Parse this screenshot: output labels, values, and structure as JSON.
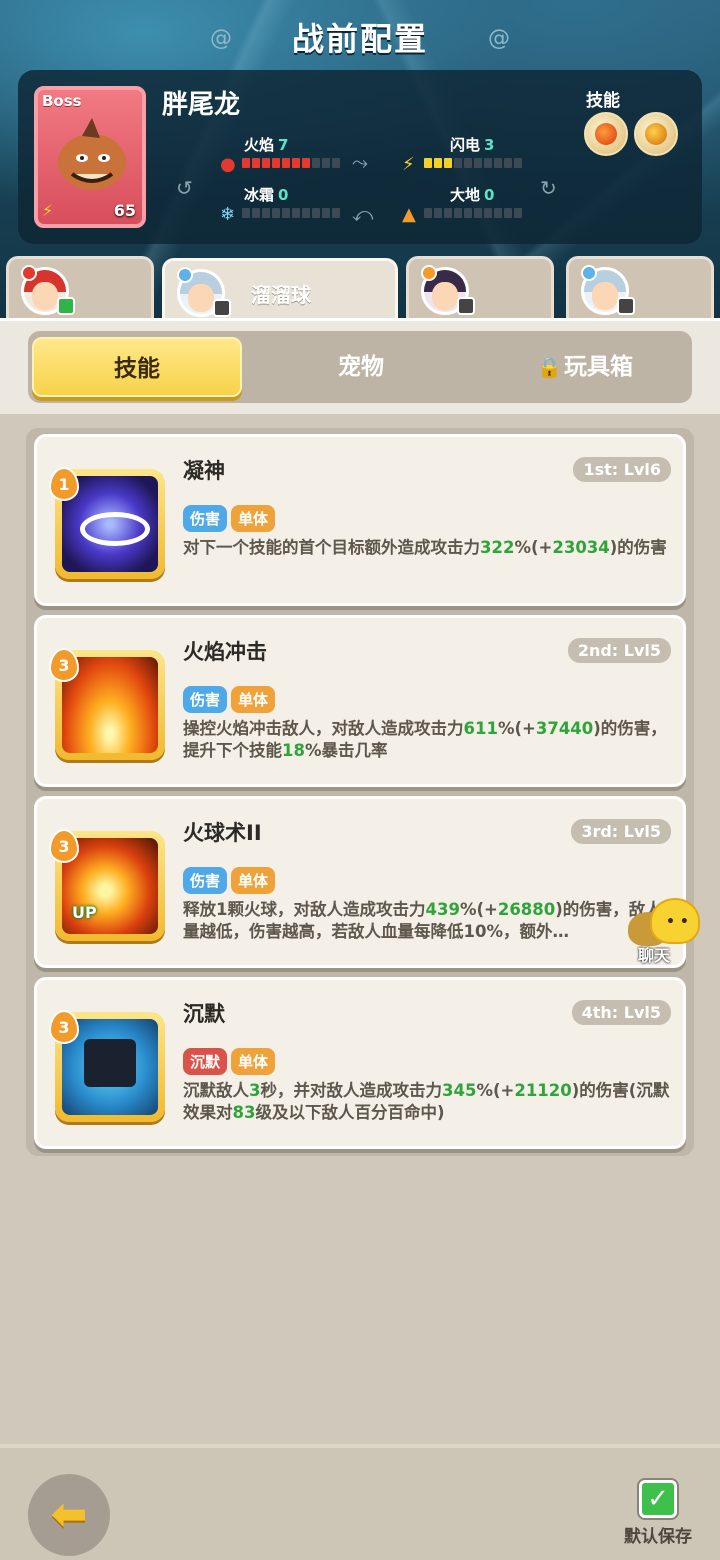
{
  "page_title": "战前配置",
  "hero": {
    "boss_tag": "Boss",
    "name": "胖尾龙",
    "level": "65",
    "skills_label": "技能",
    "stats": [
      {
        "label": "火焰",
        "value": "7",
        "filled": 7,
        "max": 10,
        "color": "fire"
      },
      {
        "label": "闪电",
        "value": "3",
        "filled": 3,
        "max": 10,
        "color": "bolt"
      },
      {
        "label": "冰霜",
        "value": "0",
        "filled": 0,
        "max": 10,
        "color": "ice"
      },
      {
        "label": "大地",
        "value": "0",
        "filled": 0,
        "max": 10,
        "color": "earth"
      }
    ]
  },
  "char_tabs": [
    {
      "name": "",
      "active": false
    },
    {
      "name": "溜溜球",
      "active": true
    },
    {
      "name": "",
      "active": false
    },
    {
      "name": "",
      "active": false
    }
  ],
  "segments": {
    "skills": "技能",
    "pets": "宠物",
    "toybox": "玩具箱"
  },
  "skills": [
    {
      "badge": "1",
      "title": "凝神",
      "level": "1st: Lvl6",
      "tags": [
        "伤害",
        "单体"
      ],
      "desc_parts": [
        "对下一个技能的首个目标额外造成攻击力",
        "322",
        "%(+",
        "23034",
        ")的伤害"
      ]
    },
    {
      "badge": "3",
      "title": "火焰冲击",
      "level": "2nd: Lvl5",
      "tags": [
        "伤害",
        "单体"
      ],
      "desc_parts": [
        "操控火焰冲击敌人，对敌人造成攻击力",
        "611",
        "%(+",
        "37440",
        ")的伤害，提升下个技能",
        "18",
        "%暴击几率"
      ]
    },
    {
      "badge": "3",
      "title": "火球术II",
      "level": "3rd: Lvl5",
      "up": "UP",
      "tags": [
        "伤害",
        "单体"
      ],
      "desc_parts": [
        "释放1颗火球，对敌人造成攻击力",
        "439",
        "%(+",
        "26880",
        ")的伤害，敌人血量越低，伤害越高，若敌人血量每降低10%，额外…"
      ]
    },
    {
      "badge": "3",
      "title": "沉默",
      "level": "4th: Lvl5",
      "tags": [
        "沉默",
        "单体"
      ],
      "desc_parts": [
        "沉默敌人",
        "3",
        "秒，并对敌人造成攻击力",
        "345",
        "%(+",
        "21120",
        ")的伤害(沉默效果对",
        "83",
        "级及以下敌人百分百命中)"
      ]
    }
  ],
  "chat_label": "聊天",
  "save_label": "默认保存"
}
